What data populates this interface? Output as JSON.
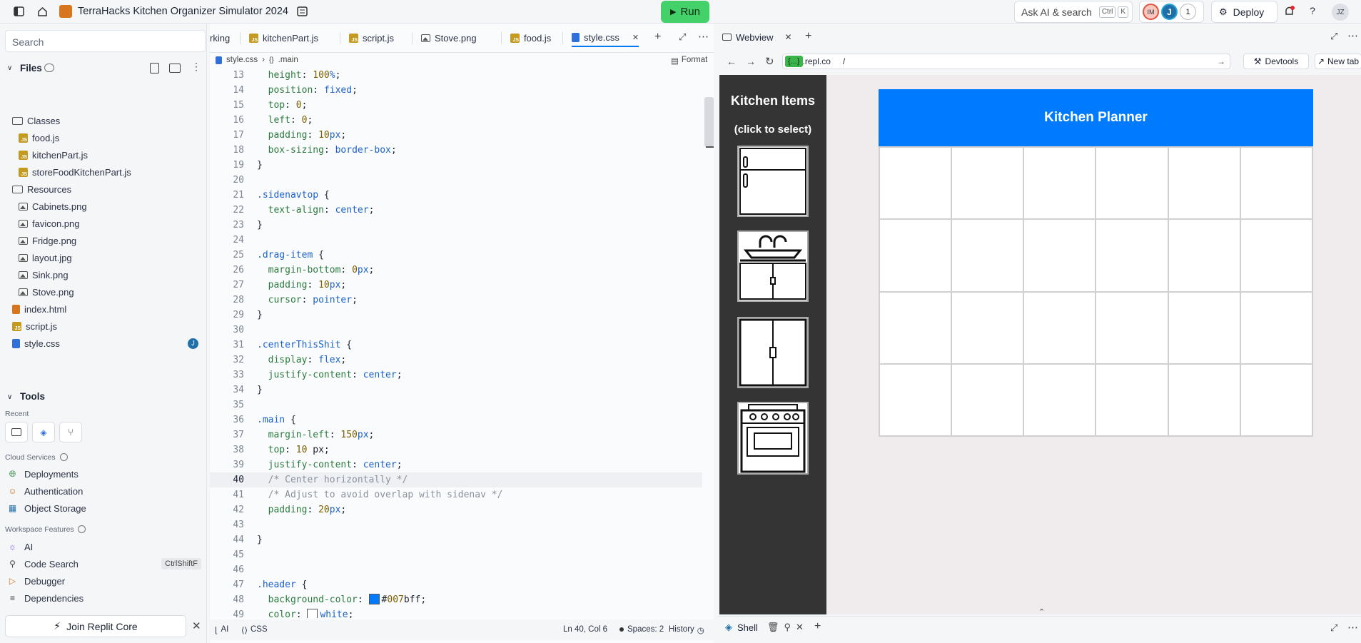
{
  "topbar": {
    "project_title": "TerraHacks Kitchen Organizer Simulator 2024",
    "run_label": "Run",
    "ask_ai_label": "Ask AI & search",
    "kbd_ctrl": "Ctrl",
    "kbd_k": "K",
    "avatar_im": "IM",
    "avatar_j": "J",
    "presence_count": "1",
    "deploy_label": "Deploy",
    "help_label": "?",
    "user_initials": "JZ"
  },
  "sidebar": {
    "search_placeholder": "Search",
    "files_heading": "Files",
    "tree": [
      {
        "label": "Classes",
        "icon": "folder-icon"
      },
      {
        "label": "food.js",
        "icon": "js-icon"
      },
      {
        "label": "kitchenPart.js",
        "icon": "js-icon"
      },
      {
        "label": "storeFoodKitchenPart.js",
        "icon": "js-icon"
      },
      {
        "label": "Resources",
        "icon": "folder-icon"
      },
      {
        "label": "Cabinets.png",
        "icon": "image-icon"
      },
      {
        "label": "favicon.png",
        "icon": "image-icon"
      },
      {
        "label": "Fridge.png",
        "icon": "image-icon"
      },
      {
        "label": "layout.jpg",
        "icon": "image-icon"
      },
      {
        "label": "Sink.png",
        "icon": "image-icon"
      },
      {
        "label": "Stove.png",
        "icon": "image-icon"
      },
      {
        "label": "index.html",
        "icon": "html-icon"
      },
      {
        "label": "script.js",
        "icon": "js-icon"
      },
      {
        "label": "style.css",
        "icon": "css-icon",
        "badge": "J"
      }
    ],
    "tools_heading": "Tools",
    "recent_label": "Recent",
    "cloud_services_label": "Cloud Services",
    "cloud_services": [
      "Deployments",
      "Authentication",
      "Object Storage"
    ],
    "workspace_features_label": "Workspace Features",
    "workspace_features": [
      "AI",
      "Code Search",
      "Debugger",
      "Dependencies"
    ],
    "code_search_shortcut": "CtrlShiftF",
    "join_label": "Join Replit Core"
  },
  "editor": {
    "tabs": [
      "rking",
      "kitchenPart.js",
      "script.js",
      "Stove.png",
      "food.js",
      "style.css"
    ],
    "active_tab": "style.css",
    "breadcrumb_file": "style.css",
    "breadcrumb_selector": ".main",
    "format_label": "Format",
    "code_lines": [
      {
        "n": "13",
        "code": "  height: 100%;"
      },
      {
        "n": "14",
        "code": "  position: fixed;"
      },
      {
        "n": "15",
        "code": "  top: 0;"
      },
      {
        "n": "16",
        "code": "  left: 0;"
      },
      {
        "n": "17",
        "code": "  padding: 10px;"
      },
      {
        "n": "18",
        "code": "  box-sizing: border-box;"
      },
      {
        "n": "19",
        "code": "}"
      },
      {
        "n": "20",
        "code": ""
      },
      {
        "n": "21",
        "code": ".sidenavtop {"
      },
      {
        "n": "22",
        "code": "  text-align: center;"
      },
      {
        "n": "23",
        "code": "}"
      },
      {
        "n": "24",
        "code": ""
      },
      {
        "n": "25",
        "code": ".drag-item {"
      },
      {
        "n": "26",
        "code": "  margin-bottom: 0px;"
      },
      {
        "n": "27",
        "code": "  padding: 10px;"
      },
      {
        "n": "28",
        "code": "  cursor: pointer;"
      },
      {
        "n": "29",
        "code": "}"
      },
      {
        "n": "30",
        "code": ""
      },
      {
        "n": "31",
        "code": ".centerThisShit {"
      },
      {
        "n": "32",
        "code": "  display: flex;"
      },
      {
        "n": "33",
        "code": "  justify-content: center;"
      },
      {
        "n": "34",
        "code": "}"
      },
      {
        "n": "35",
        "code": ""
      },
      {
        "n": "36",
        "code": ".main {"
      },
      {
        "n": "37",
        "code": "  margin-left: 150px;"
      },
      {
        "n": "38",
        "code": "  top: 10 px;"
      },
      {
        "n": "39",
        "code": "  justify-content: center;"
      },
      {
        "n": "40",
        "code": "  /* Center horizontally */"
      },
      {
        "n": "41",
        "code": "  /* Adjust to avoid overlap with sidenav */"
      },
      {
        "n": "42",
        "code": "  padding: 20px;"
      },
      {
        "n": "43",
        "code": ""
      },
      {
        "n": "44",
        "code": "}"
      },
      {
        "n": "45",
        "code": ""
      },
      {
        "n": "46",
        "code": ""
      },
      {
        "n": "47",
        "code": ".header {"
      },
      {
        "n": "48",
        "code": "  background-color: #007bff;"
      },
      {
        "n": "49",
        "code": "  color: white;"
      }
    ],
    "status": {
      "ai": "AI",
      "lang": "CSS",
      "cursor": "Ln 40, Col 6",
      "spaces": "Spaces: 2",
      "history": "History"
    }
  },
  "webview": {
    "tab_label": "Webview",
    "url_host": ".repl.co",
    "url_host_prefix": "{...}",
    "url_path": "/",
    "devtools_label": "Devtools",
    "newtab_label": "New tab",
    "app": {
      "sidebar_title": "Kitchen Items",
      "sidebar_subtitle": "(click to select)",
      "items": [
        "fridge",
        "sink",
        "cabinets",
        "stove"
      ],
      "planner_title": "Kitchen Planner",
      "header_color": "#007bff"
    },
    "shell_label": "Shell"
  },
  "colors": {
    "run_green": "#44d16a",
    "accent_blue": "#0079f2",
    "planner_blue": "#007bff",
    "app_sidebar": "#343434"
  }
}
